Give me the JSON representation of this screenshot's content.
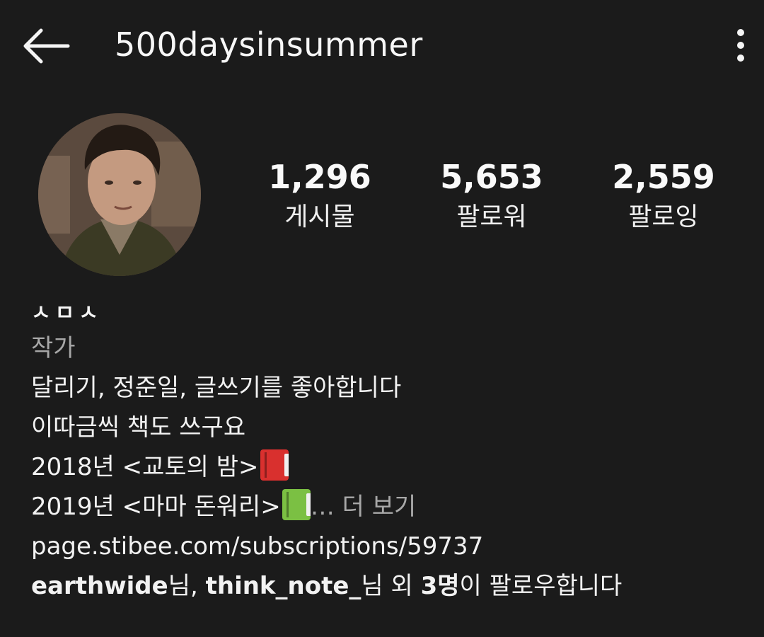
{
  "header": {
    "username": "500daysinsummer",
    "back_icon": "arrow-left-icon",
    "more_icon": "more-vertical-icon"
  },
  "stats": {
    "posts": {
      "count": "1,296",
      "label": "게시물"
    },
    "followers": {
      "count": "5,653",
      "label": "팔로워"
    },
    "following": {
      "count": "2,559",
      "label": "팔로잉"
    }
  },
  "bio": {
    "name": "ㅅㅁㅅ",
    "category": "작가",
    "line1": "달리기, 정준일, 글쓰기를 좋아합니다",
    "line2": "이따금씩 책도 쓰구요",
    "line3": "2018년 <교토의 밤>",
    "line4": "2019년 <마마 돈워리>",
    "ellipsis": "…",
    "more_label": " 더 보기",
    "link": "page.stibee.com/subscriptions/59737",
    "followed_by": {
      "user1": "earthwide",
      "sep1": "님, ",
      "user2": "think_note_",
      "sep2": "님 외 ",
      "count": "3명",
      "suffix": "이 팔로우합니다"
    }
  },
  "colors": {
    "background": "#1b1b1b",
    "text": "#f5f5f5",
    "muted": "#a8a8a8",
    "link": "#c5dcf5",
    "book_red": "#d9302e",
    "book_green": "#7bc043"
  }
}
